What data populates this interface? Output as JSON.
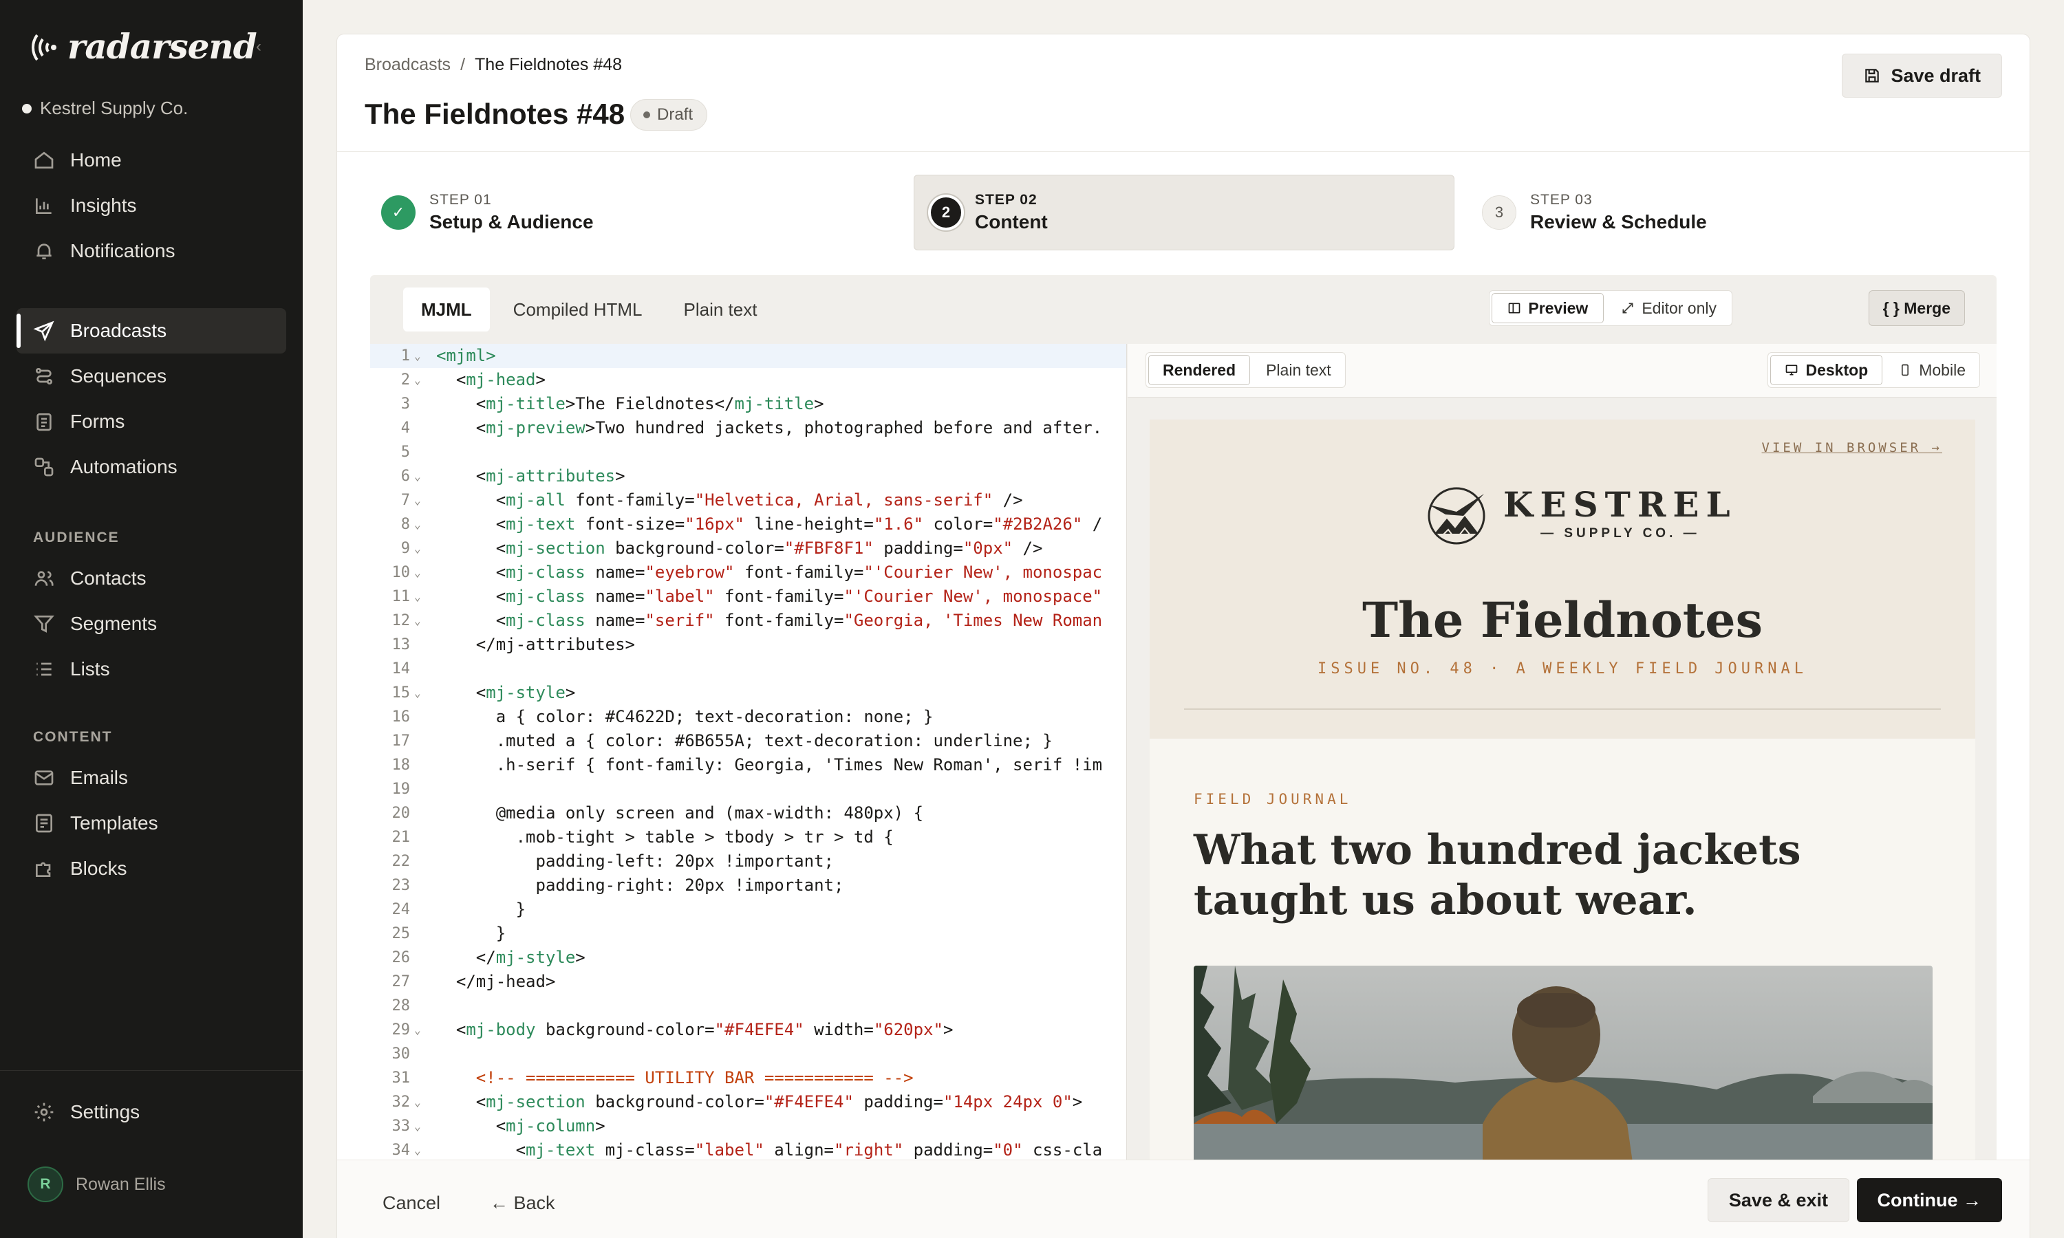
{
  "sidebar": {
    "brand": "radarsend",
    "collapse_icon": "chevron-left-icon",
    "workspace": "Kestrel Supply Co.",
    "nav_main": [
      {
        "label": "Home",
        "icon": "home-icon"
      },
      {
        "label": "Insights",
        "icon": "bar-chart-icon"
      },
      {
        "label": "Notifications",
        "icon": "bell-icon"
      }
    ],
    "nav_send": [
      {
        "label": "Broadcasts",
        "icon": "send-icon",
        "active": true
      },
      {
        "label": "Sequences",
        "icon": "sequence-icon"
      },
      {
        "label": "Forms",
        "icon": "form-icon"
      },
      {
        "label": "Automations",
        "icon": "automation-icon"
      }
    ],
    "audience_label": "AUDIENCE",
    "nav_audience": [
      {
        "label": "Contacts",
        "icon": "users-icon"
      },
      {
        "label": "Segments",
        "icon": "filter-icon"
      },
      {
        "label": "Lists",
        "icon": "list-icon"
      }
    ],
    "content_label": "CONTENT",
    "nav_content": [
      {
        "label": "Emails",
        "icon": "mail-icon"
      },
      {
        "label": "Templates",
        "icon": "template-icon"
      },
      {
        "label": "Blocks",
        "icon": "puzzle-icon"
      }
    ],
    "settings_label": "Settings",
    "user": {
      "initial": "R",
      "name": "Rowan Ellis"
    }
  },
  "header": {
    "breadcrumb": {
      "parent": "Broadcasts",
      "separator": "/",
      "current": "The Fieldnotes #48"
    },
    "title": "The Fieldnotes #48",
    "status": "Draft",
    "save_draft": "Save draft"
  },
  "steps": [
    {
      "kicker": "STEP 01",
      "title": "Setup & Audience",
      "state": "done",
      "marker": "✓"
    },
    {
      "kicker": "STEP 02",
      "title": "Content",
      "state": "current",
      "marker": "2"
    },
    {
      "kicker": "STEP 03",
      "title": "Review & Schedule",
      "state": "todo",
      "marker": "3"
    }
  ],
  "editor": {
    "tabs": [
      "MJML",
      "Compiled HTML",
      "Plain text"
    ],
    "active_tab": "MJML",
    "view_modes": [
      "Preview",
      "Editor only"
    ],
    "active_view": "Preview",
    "merge_label": "{ } Merge",
    "code_lines": [
      [
        [
          "t",
          "<mjml>"
        ]
      ],
      [
        [
          "p",
          "  "
        ],
        [
          "p",
          "<"
        ],
        [
          "t",
          "mj-head"
        ],
        [
          "p",
          ">"
        ]
      ],
      [
        [
          "p",
          "    <"
        ],
        [
          "t",
          "mj-title"
        ],
        [
          "p",
          ">The Fieldnotes</"
        ],
        [
          "t",
          "mj-title"
        ],
        [
          "p",
          ">"
        ]
      ],
      [
        [
          "p",
          "    <"
        ],
        [
          "t",
          "mj-preview"
        ],
        [
          "p",
          ">Two hundred jackets, photographed before and after."
        ]
      ],
      [
        [
          "p",
          ""
        ]
      ],
      [
        [
          "p",
          "    <"
        ],
        [
          "t",
          "mj-attributes"
        ],
        [
          "p",
          ">"
        ]
      ],
      [
        [
          "p",
          "      <"
        ],
        [
          "t",
          "mj-all"
        ],
        [
          "p",
          " font-family="
        ],
        [
          "s",
          "\"Helvetica, Arial, sans-serif\""
        ],
        [
          "p",
          " />"
        ]
      ],
      [
        [
          "p",
          "      <"
        ],
        [
          "t",
          "mj-text"
        ],
        [
          "p",
          " font-size="
        ],
        [
          "s",
          "\"16px\""
        ],
        [
          "p",
          " line-height="
        ],
        [
          "s",
          "\"1.6\""
        ],
        [
          "p",
          " color="
        ],
        [
          "s",
          "\"#2B2A26\""
        ],
        [
          "p",
          " /"
        ]
      ],
      [
        [
          "p",
          "      <"
        ],
        [
          "t",
          "mj-section"
        ],
        [
          "p",
          " background-color="
        ],
        [
          "s",
          "\"#FBF8F1\""
        ],
        [
          "p",
          " padding="
        ],
        [
          "s",
          "\"0px\""
        ],
        [
          "p",
          " />"
        ]
      ],
      [
        [
          "p",
          "      <"
        ],
        [
          "t",
          "mj-class"
        ],
        [
          "p",
          " name="
        ],
        [
          "s",
          "\"eyebrow\""
        ],
        [
          "p",
          " font-family="
        ],
        [
          "s",
          "\"'Courier New', monospac"
        ]
      ],
      [
        [
          "p",
          "      <"
        ],
        [
          "t",
          "mj-class"
        ],
        [
          "p",
          " name="
        ],
        [
          "s",
          "\"label\""
        ],
        [
          "p",
          " font-family="
        ],
        [
          "s",
          "\"'Courier New', monospace\""
        ]
      ],
      [
        [
          "p",
          "      <"
        ],
        [
          "t",
          "mj-class"
        ],
        [
          "p",
          " name="
        ],
        [
          "s",
          "\"serif\""
        ],
        [
          "p",
          " font-family="
        ],
        [
          "s",
          "\"Georgia, 'Times New Roman"
        ]
      ],
      [
        [
          "p",
          "    </mj-attributes>"
        ]
      ],
      [
        [
          "p",
          ""
        ]
      ],
      [
        [
          "p",
          "    <"
        ],
        [
          "t",
          "mj-style"
        ],
        [
          "p",
          ">"
        ]
      ],
      [
        [
          "p",
          "      a { color: #C4622D; text-decoration: none; }"
        ]
      ],
      [
        [
          "p",
          "      .muted a { color: #6B655A; text-decoration: underline; }"
        ]
      ],
      [
        [
          "p",
          "      .h-serif { font-family: Georgia, 'Times New Roman', serif !im"
        ]
      ],
      [
        [
          "p",
          ""
        ]
      ],
      [
        [
          "p",
          "      @media only screen and (max-width: 480px) {"
        ]
      ],
      [
        [
          "p",
          "        .mob-tight > table > tbody > tr > td {"
        ]
      ],
      [
        [
          "p",
          "          padding-left: 20px !important;"
        ]
      ],
      [
        [
          "p",
          "          padding-right: 20px !important;"
        ]
      ],
      [
        [
          "p",
          "        }"
        ]
      ],
      [
        [
          "p",
          "      }"
        ]
      ],
      [
        [
          "p",
          "    </"
        ],
        [
          "t",
          "mj-style"
        ],
        [
          "p",
          ">"
        ]
      ],
      [
        [
          "p",
          "  </mj-head>"
        ]
      ],
      [
        [
          "p",
          ""
        ]
      ],
      [
        [
          "p",
          "  <"
        ],
        [
          "t",
          "mj-body"
        ],
        [
          "p",
          " background-color="
        ],
        [
          "s",
          "\"#F4EFE4\""
        ],
        [
          "p",
          " width="
        ],
        [
          "s",
          "\"620px\""
        ],
        [
          "p",
          ">"
        ]
      ],
      [
        [
          "p",
          ""
        ]
      ],
      [
        [
          "c",
          "    <!-- =========== UTILITY BAR =========== -->"
        ]
      ],
      [
        [
          "p",
          "    <"
        ],
        [
          "t",
          "mj-section"
        ],
        [
          "p",
          " background-color="
        ],
        [
          "s",
          "\"#F4EFE4\""
        ],
        [
          "p",
          " padding="
        ],
        [
          "s",
          "\"14px 24px 0\""
        ],
        [
          "p",
          ">"
        ]
      ],
      [
        [
          "p",
          "      <"
        ],
        [
          "t",
          "mj-column"
        ],
        [
          "p",
          ">"
        ]
      ],
      [
        [
          "p",
          "        <"
        ],
        [
          "t",
          "mj-text"
        ],
        [
          "p",
          " mj-class="
        ],
        [
          "s",
          "\"label\""
        ],
        [
          "p",
          " align="
        ],
        [
          "s",
          "\"right\""
        ],
        [
          "p",
          " padding="
        ],
        [
          "s",
          "\"0\""
        ],
        [
          "p",
          " css-cla"
        ]
      ]
    ],
    "fold_lines": [
      1,
      2,
      6,
      7,
      8,
      9,
      10,
      11,
      12,
      15,
      29,
      32,
      33,
      34
    ]
  },
  "preview": {
    "modes": [
      "Rendered",
      "Plain text"
    ],
    "active_mode": "Rendered",
    "devices": [
      "Desktop",
      "Mobile"
    ],
    "active_device": "Desktop",
    "email": {
      "view_in_browser": "VIEW IN BROWSER →",
      "brand_name": "KESTREL",
      "brand_sub": "— SUPPLY CO. —",
      "title": "The Fieldnotes",
      "issue": "ISSUE NO. 48 · A WEEKLY FIELD JOURNAL",
      "eyebrow": "FIELD JOURNAL",
      "headline": "What two hundred jackets taught us about wear."
    }
  },
  "footer": {
    "cancel": "Cancel",
    "back": "← Back",
    "save_exit": "Save & exit",
    "continue": "Continue →"
  },
  "colors": {
    "sidebar_bg": "#1A1A18",
    "accent_done": "#2D9A62",
    "code_tag": "#2D8A5A",
    "code_string": "#B42318",
    "email_accent": "#B4723A"
  }
}
